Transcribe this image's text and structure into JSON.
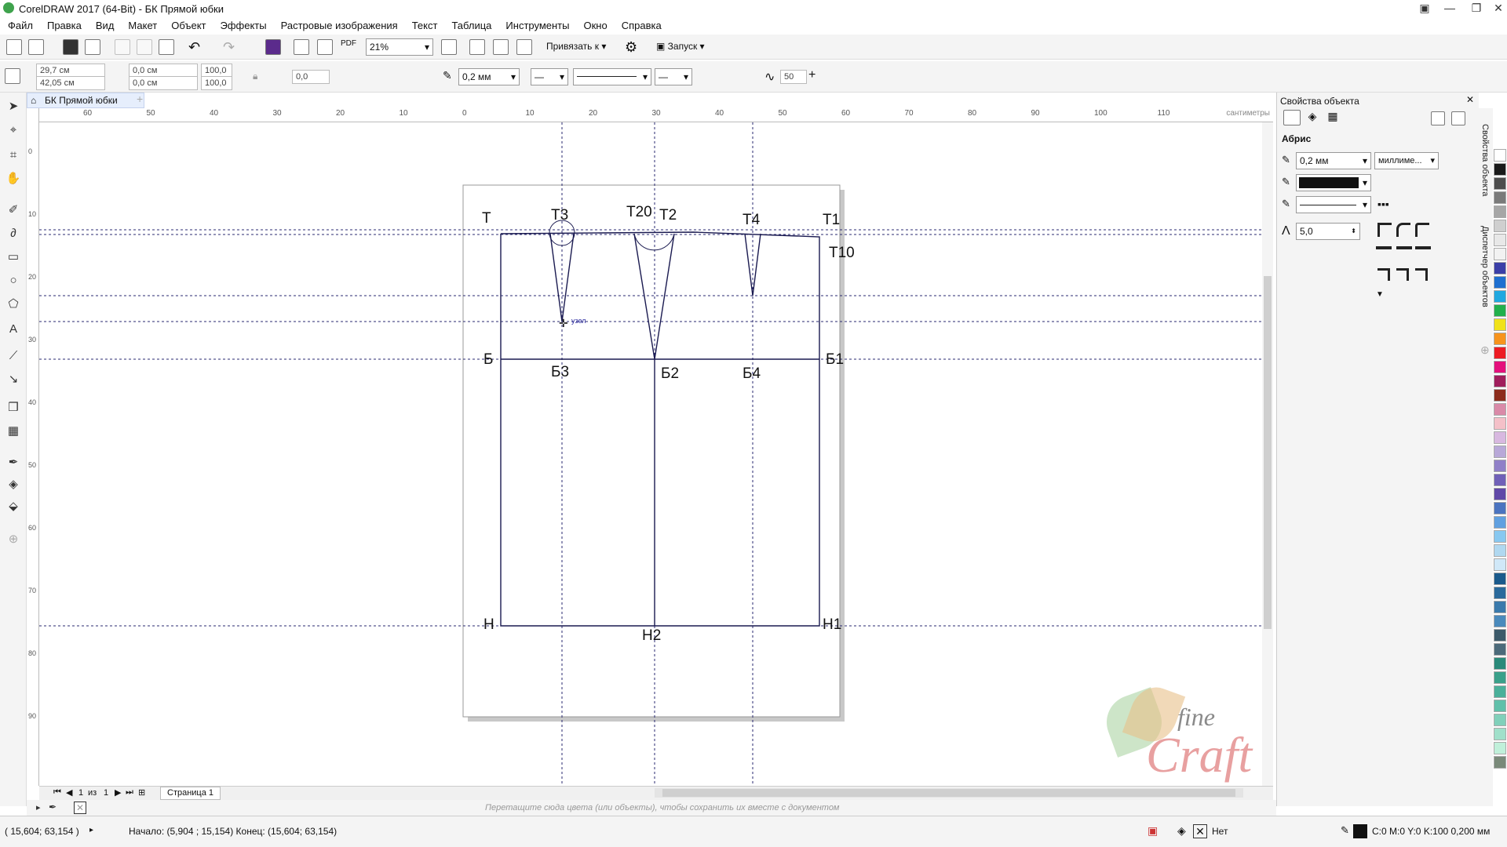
{
  "window": {
    "title": "CorelDRAW 2017 (64-Bit) - БК Прямой юбки"
  },
  "menu": [
    "Файл",
    "Правка",
    "Вид",
    "Макет",
    "Объект",
    "Эффекты",
    "Растровые изображения",
    "Текст",
    "Таблица",
    "Инструменты",
    "Окно",
    "Справка"
  ],
  "toolbar": {
    "zoom": "21%",
    "snap_label": "Привязать к",
    "launch_label": "Запуск"
  },
  "propbar": {
    "width": "29,7 см",
    "height": "42,05 см",
    "x": "0,0 см",
    "y": "0,0 см",
    "scale_x": "100,0",
    "scale_y": "100,0",
    "angle": "0,0",
    "outline_width": "0,2 мм",
    "smoothing": "50"
  },
  "doc_tab": "БК Прямой юбки",
  "ruler": {
    "unit_label": "сантиметры",
    "h_ticks": [
      "60",
      "50",
      "40",
      "30",
      "20",
      "10",
      "0",
      "10",
      "20",
      "30",
      "40",
      "50",
      "60",
      "70",
      "80",
      "90",
      "100",
      "110"
    ],
    "v_ticks": [
      "0",
      "10",
      "20",
      "30",
      "40",
      "50",
      "60",
      "70",
      "80",
      "90"
    ]
  },
  "drawing": {
    "labels": {
      "T": "Т",
      "T3": "Т3",
      "T20": "Т20",
      "T2": "Т2",
      "T4": "Т4",
      "T1": "Т1",
      "T10": "Т10",
      "B": "Б",
      "B3": "Б3",
      "B2": "Б2",
      "B4": "Б4",
      "B1": "Б1",
      "H": "Н",
      "H2": "Н2",
      "H1": "Н1"
    },
    "cursor_hint": "узел"
  },
  "pages": {
    "current": "1",
    "of_label": "из",
    "total": "1",
    "page_tab": "Страница 1"
  },
  "hint": "Перетащите сюда цвета (или объекты), чтобы сохранить их вместе с документом",
  "status": {
    "cursor": "( 15,604; 63,154 )",
    "start_end": "Начало: (5,904 ; 15,154)  Конец: (15,604; 63,154)",
    "fill": "Нет",
    "outline": "C:0 M:0 Y:0 K:100  0,200 мм"
  },
  "panel": {
    "title": "Свойства объекта",
    "section": "Абрис",
    "width": "0,2 мм",
    "units": "миллиме...",
    "miter": "5,0",
    "vtab1": "Свойства объекта",
    "vtab2": "Диспетчер объектов"
  },
  "colors": {
    "palette": [
      "#ffffff",
      "#1a1a1a",
      "#4d4d4d",
      "#7a7a7a",
      "#a6a6a6",
      "#cfcfcf",
      "#e8e8e8",
      "#f2f2f2",
      "#3b3fa8",
      "#1e6fd0",
      "#20a8e0",
      "#22b04c",
      "#f0e21a",
      "#f7941d",
      "#ed1c24",
      "#e4107c",
      "#a01e5c",
      "#8c2c1c",
      "#d98aa8",
      "#f4c0c8",
      "#d8b8e0",
      "#b8a8d8",
      "#9080c8",
      "#7060b8",
      "#6048a8",
      "#4b74c0",
      "#60a0e0",
      "#88c8f0",
      "#b0d8f0",
      "#d0e8f8",
      "#1a5a8c",
      "#2a6a9c",
      "#3a7aac",
      "#4a8abc",
      "#3c5a6a",
      "#4c6a7a",
      "#2a8a7a",
      "#3aa08a",
      "#4ab09a",
      "#60c0aa",
      "#80d0ba",
      "#a0e0ca",
      "#c0f0da",
      "#7a8a7a"
    ]
  }
}
